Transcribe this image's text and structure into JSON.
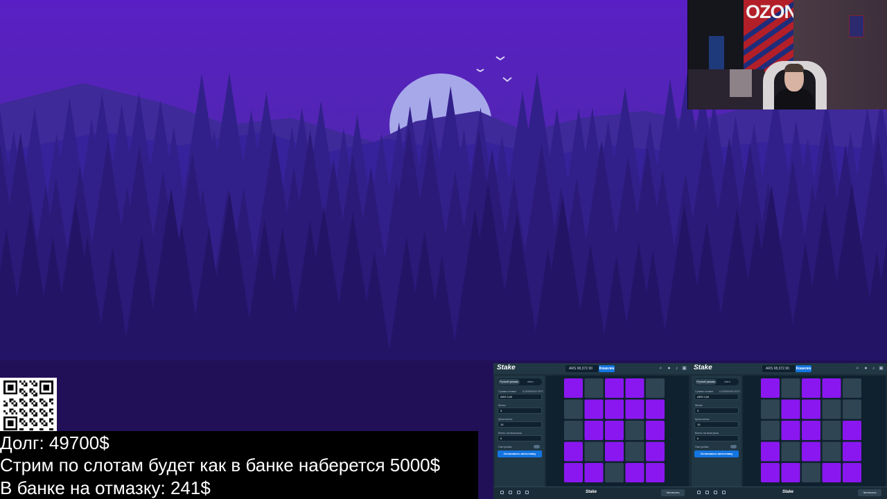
{
  "stream_overlay": {
    "debt_line": "Долг: 49700$",
    "slots_stream_line": "Стрим по слотам будет как в банке наберется 5000$",
    "bank_line": "В банке на отмазку: 241$",
    "webcam_sign": "OZON"
  },
  "games": [
    {
      "logo": "Stake",
      "balance": "ARS 98,372.90",
      "wallet_button": "Кошелек",
      "tabs": [
        "Ручной режим",
        "Авто"
      ],
      "bet_label": "Сумма ставки",
      "bet_sub": "0,00000001 BTC",
      "bet_value": "ARS 0,00",
      "mines_label": "Мины",
      "mines_value": "3",
      "gems_label": "Кристаллы",
      "gems_value": "10",
      "profit_label": "Всего на выигрыш",
      "profit_value": "0",
      "settings_label": "Настройки",
      "action_button": "Остановить автоставку",
      "footer_logo": "Stake",
      "fairness_button": "Честность",
      "tiles": [
        "gem",
        "empty",
        "gem",
        "gem",
        "empty",
        "empty",
        "gem",
        "gem",
        "gem",
        "gem",
        "empty",
        "gem",
        "gem",
        "empty",
        "gem",
        "gem",
        "empty",
        "gem",
        "empty",
        "gem",
        "gem",
        "gem",
        "empty",
        "gem",
        "gem"
      ]
    },
    {
      "logo": "Stake",
      "balance": "ARS 98,372.90",
      "wallet_button": "Кошелек",
      "tabs": [
        "Ручной режим",
        "Авто"
      ],
      "bet_label": "Сумма ставки",
      "bet_sub": "0,00000001 BTC",
      "bet_value": "ARS 0,00",
      "mines_label": "Мины",
      "mines_value": "3",
      "gems_label": "Кристаллы",
      "gems_value": "10",
      "profit_label": "Всего на выигрыш",
      "profit_value": "0",
      "settings_label": "Настройки",
      "action_button": "Остановить автоставку",
      "footer_logo": "Stake",
      "fairness_button": "Честность",
      "tiles": [
        "gem",
        "empty",
        "gem",
        "gem",
        "empty",
        "empty",
        "gem",
        "gem",
        "empty",
        "empty",
        "empty",
        "gem",
        "gem",
        "empty",
        "gem",
        "gem",
        "empty",
        "gem",
        "empty",
        "gem",
        "gem",
        "gem",
        "empty",
        "gem",
        "gem"
      ]
    }
  ],
  "colors": {
    "gem_tile": "#8a17f0",
    "empty_tile": "#2f4553",
    "accent": "#1475e1"
  }
}
